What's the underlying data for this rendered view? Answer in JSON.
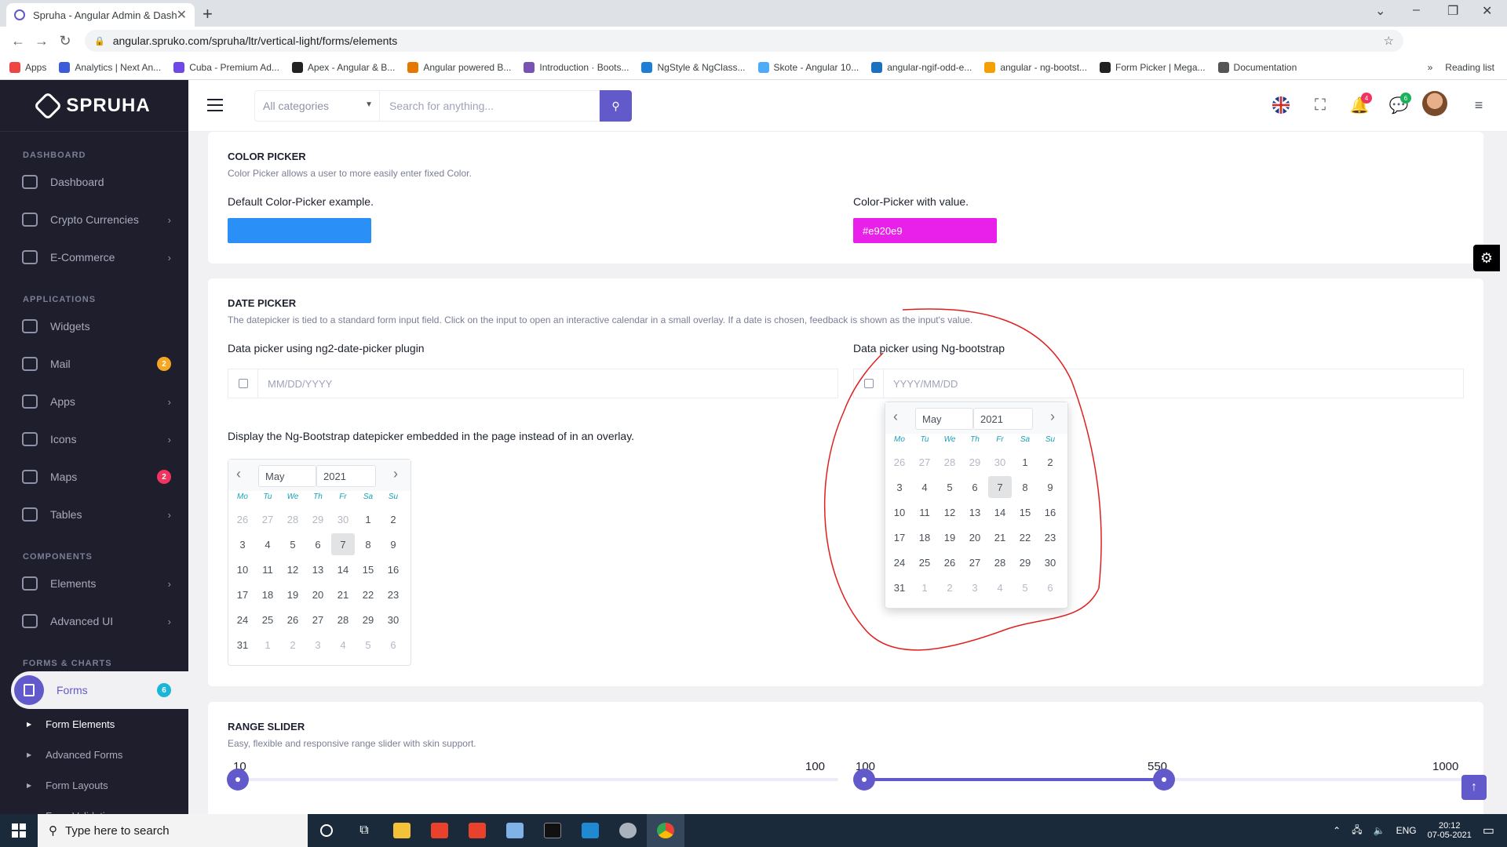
{
  "browser": {
    "tab_title": "Spruha - Angular Admin & Dash",
    "url": "angular.spruko.com/spruha/ltr/vertical-light/forms/elements",
    "bookmarks": [
      {
        "label": "Apps",
        "color": "#e44"
      },
      {
        "label": "Analytics | Next An...",
        "color": "#3b5bdb"
      },
      {
        "label": "Cuba - Premium Ad...",
        "color": "#7048e8"
      },
      {
        "label": "Apex - Angular & B...",
        "color": "#222"
      },
      {
        "label": "Angular powered B...",
        "color": "#e67700"
      },
      {
        "label": "Introduction · Boots...",
        "color": "#7952b3"
      },
      {
        "label": "NgStyle & NgClass...",
        "color": "#1c7ed6"
      },
      {
        "label": "Skote - Angular 10...",
        "color": "#4dabf7"
      },
      {
        "label": "angular-ngif-odd-e...",
        "color": "#1971c2"
      },
      {
        "label": "angular - ng-bootst...",
        "color": "#f59f00"
      },
      {
        "label": "Form Picker | Mega...",
        "color": "#222"
      },
      {
        "label": "Documentation",
        "color": "#555"
      }
    ],
    "bookmarks_more": "»",
    "reading_list": "Reading list"
  },
  "sidebar": {
    "brand": "SPRUHA",
    "sections": [
      {
        "title": "DASHBOARD",
        "items": [
          {
            "label": "Dashboard",
            "chevron": false
          },
          {
            "label": "Crypto Currencies",
            "chevron": true
          },
          {
            "label": "E-Commerce",
            "chevron": true
          }
        ]
      },
      {
        "title": "APPLICATIONS",
        "items": [
          {
            "label": "Widgets",
            "chevron": false
          },
          {
            "label": "Mail",
            "badge": "2",
            "badge_color": "#f5a623"
          },
          {
            "label": "Apps",
            "chevron": true
          },
          {
            "label": "Icons",
            "chevron": true
          },
          {
            "label": "Maps",
            "badge": "2",
            "badge_color": "#f0345f"
          },
          {
            "label": "Tables",
            "chevron": true
          }
        ]
      },
      {
        "title": "COMPONENTS",
        "items": [
          {
            "label": "Elements",
            "chevron": true
          },
          {
            "label": "Advanced UI",
            "chevron": true
          }
        ]
      },
      {
        "title": "FORMS & CHARTS",
        "items": []
      }
    ],
    "active": {
      "label": "Forms",
      "badge": "6"
    },
    "subitems": [
      "Form Elements",
      "Advanced Forms",
      "Form Layouts",
      "Form Validation"
    ]
  },
  "header": {
    "category_placeholder": "All categories",
    "search_placeholder": "Search for anything...",
    "notif_count": "4",
    "chat_count": "6"
  },
  "color_picker": {
    "title": "COLOR PICKER",
    "subtitle": "Color Picker allows a user to more easily enter fixed Color.",
    "default_label": "Default Color-Picker example.",
    "default_color": "#2a8ff7",
    "value_label": "Color-Picker with value.",
    "value": "#e920e9"
  },
  "date_picker": {
    "title": "DATE PICKER",
    "subtitle": "The datepicker is tied to a standard form input field. Click on the input to open an interactive calendar in a small overlay. If a date is chosen, feedback is shown as the input's value.",
    "left_label": "Data picker using ng2-date-picker plugin",
    "left_placeholder": "MM/DD/YYYY",
    "right_label": "Data picker using Ng-bootstrap",
    "right_placeholder": "YYYY/MM/DD",
    "embedded_label": "Display the Ng-Bootstrap datepicker embedded in the page instead of in an overlay.",
    "month": "May",
    "year": "2021",
    "weekdays": [
      "Mo",
      "Tu",
      "We",
      "Th",
      "Fr",
      "Sa",
      "Su"
    ],
    "weeks": [
      [
        "26",
        "27",
        "28",
        "29",
        "30",
        "1",
        "2"
      ],
      [
        "3",
        "4",
        "5",
        "6",
        "7",
        "8",
        "9"
      ],
      [
        "10",
        "11",
        "12",
        "13",
        "14",
        "15",
        "16"
      ],
      [
        "17",
        "18",
        "19",
        "20",
        "21",
        "22",
        "23"
      ],
      [
        "24",
        "25",
        "26",
        "27",
        "28",
        "29",
        "30"
      ],
      [
        "31",
        "1",
        "2",
        "3",
        "4",
        "5",
        "6"
      ]
    ],
    "today": "7"
  },
  "range_slider": {
    "title": "RANGE SLIDER",
    "subtitle": "Easy, flexible and responsive range slider with skin support.",
    "single": {
      "value": "10",
      "max": "100",
      "fraction": 0
    },
    "double": {
      "min": "100",
      "value": "550",
      "max": "1000",
      "fraction_low": 0,
      "fraction_high": 0.5
    }
  },
  "taskbar": {
    "search_placeholder": "Type here to search",
    "lang": "ENG",
    "time": "20:12",
    "date": "07-05-2021"
  }
}
